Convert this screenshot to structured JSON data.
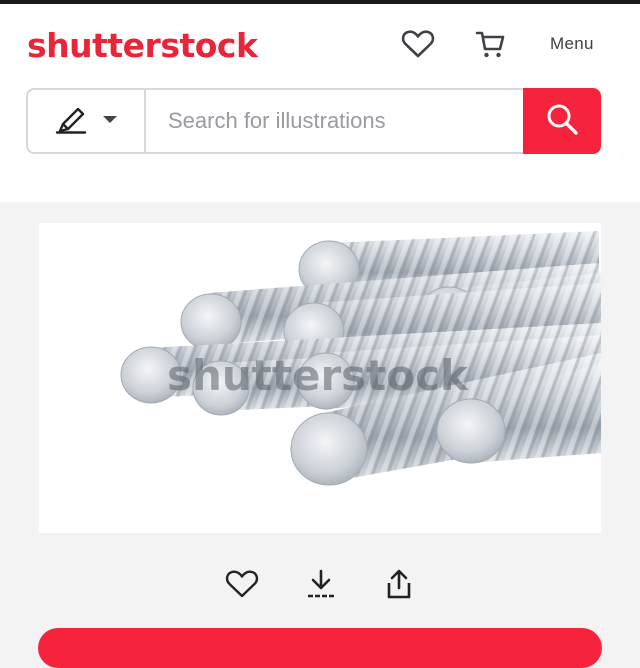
{
  "header": {
    "logo_text": "shutterstock",
    "favorites_icon": "heart-icon",
    "cart_icon": "cart-icon",
    "menu_label": "Menu"
  },
  "search": {
    "type_icon": "pen-icon",
    "dropdown_icon": "caret-down-icon",
    "placeholder": "Search for illustrations",
    "value": "",
    "button_icon": "search-icon"
  },
  "preview": {
    "subject": "steel rebar bars",
    "watermark": "shutterstock"
  },
  "actions": {
    "save_icon": "heart-icon",
    "download_icon": "download-icon",
    "share_icon": "share-icon"
  },
  "colors": {
    "brand": "#e9253a",
    "accent": "#f5243c",
    "page_bg": "#f3f3f4"
  }
}
